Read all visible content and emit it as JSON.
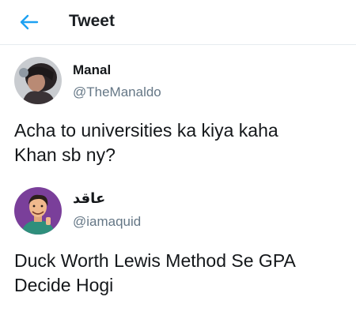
{
  "header": {
    "back_icon": "arrow-left-icon",
    "title": "Tweet"
  },
  "colors": {
    "accent": "#1da1f2",
    "handle": "#657786",
    "text": "#14171a"
  },
  "tweets": [
    {
      "name": "Manal",
      "handle": "@TheManaldo",
      "avatar_icon": "user-avatar",
      "lines": [
        "Acha to universities ka kiya kaha",
        "Khan sb ny?"
      ]
    },
    {
      "name": "عاقد",
      "handle": "@iamaquid",
      "avatar_icon": "user-avatar",
      "lines": [
        "Duck Worth Lewis Method Se GPA",
        "Decide Hogi"
      ]
    }
  ]
}
